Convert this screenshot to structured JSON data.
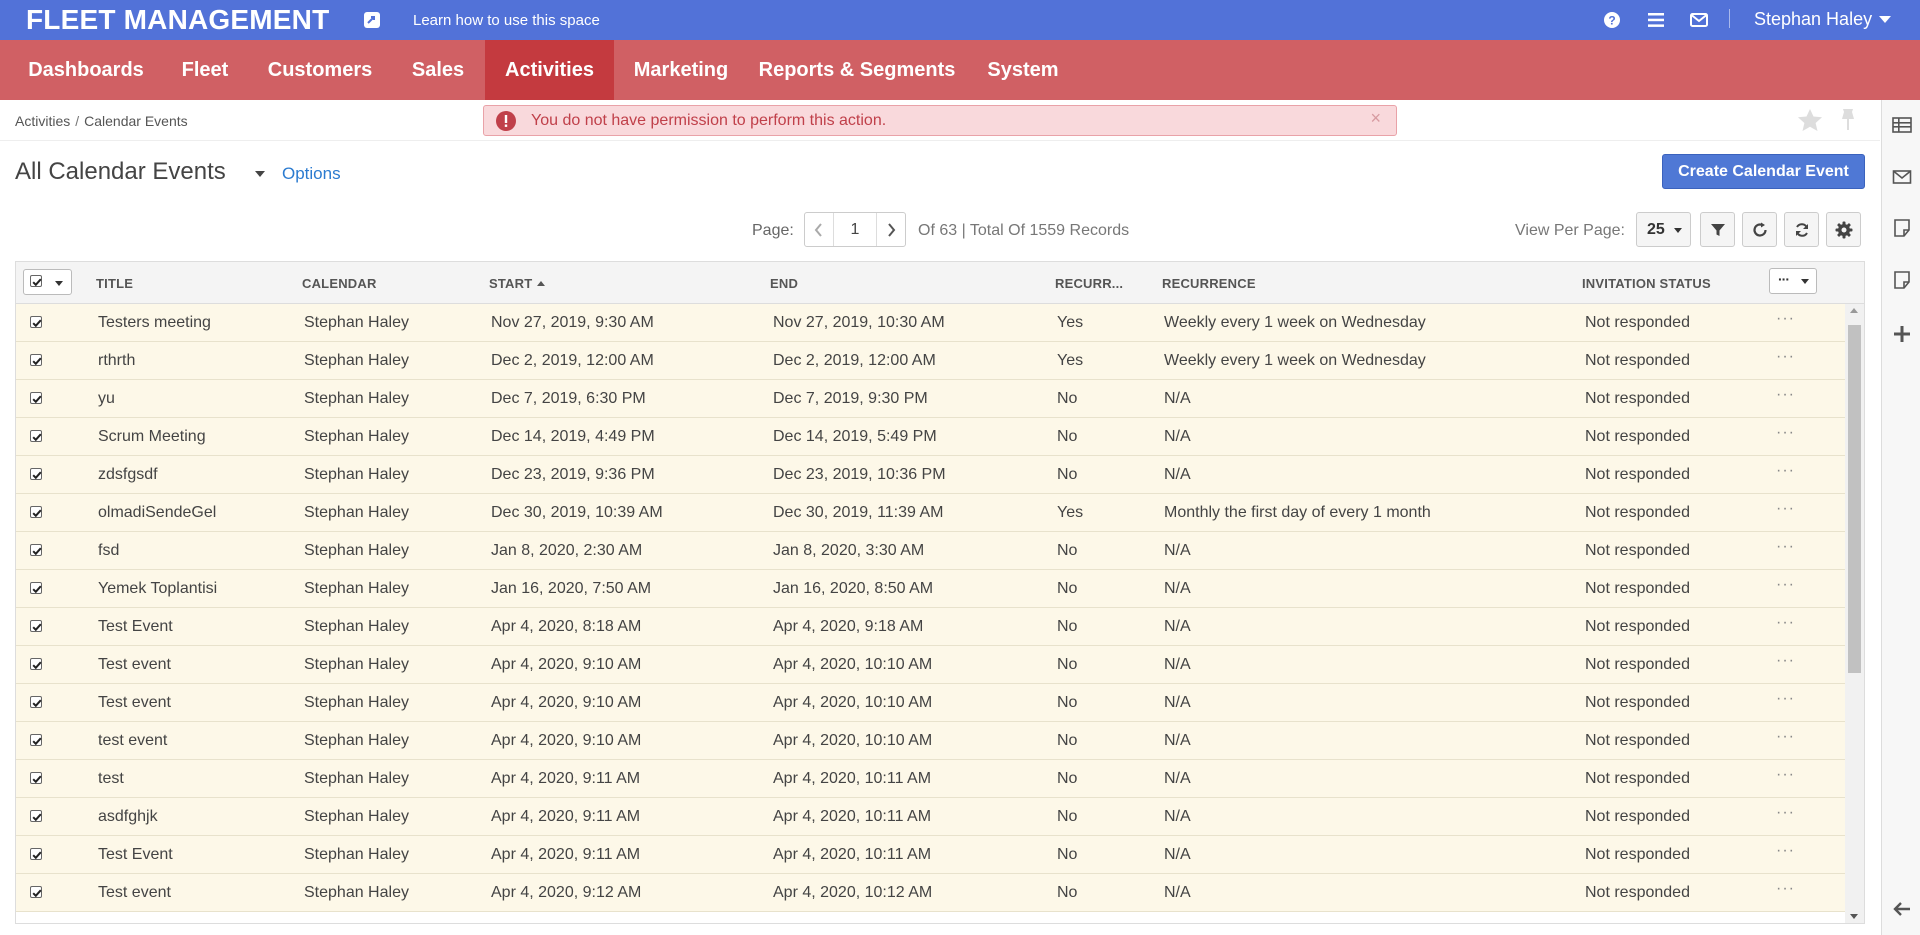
{
  "header": {
    "brand": "FLEET MANAGEMENT",
    "learn_link": "Learn how to use this space",
    "user_name": "Stephan Haley",
    "icons": [
      "help-icon",
      "list-icon",
      "mail-icon"
    ]
  },
  "nav": {
    "items": [
      "Dashboards",
      "Fleet",
      "Customers",
      "Sales",
      "Activities",
      "Marketing",
      "Reports & Segments",
      "System"
    ],
    "active": "Activities"
  },
  "breadcrumb": {
    "parent": "Activities",
    "current": "Calendar Events"
  },
  "alert": {
    "message": "You do not have permission to perform this action.",
    "close": "×"
  },
  "page": {
    "title": "All Calendar Events",
    "options_label": "Options",
    "create_button": "Create Calendar Event"
  },
  "pager": {
    "label": "Page:",
    "current": "1",
    "info": "Of 63 | Total Of 1559 Records",
    "view_per_page_label": "View Per Page:",
    "per_page": "25"
  },
  "grid": {
    "columns": [
      "TITLE",
      "CALENDAR",
      "START",
      "END",
      "RECURR...",
      "RECURRENCE",
      "INVITATION STATUS"
    ],
    "row_menu": "···",
    "rows": [
      [
        "Testers meeting",
        "Stephan Haley",
        "Nov 27, 2019, 9:30 AM",
        "Nov 27, 2019, 10:30 AM",
        "Yes",
        "Weekly every 1 week on Wednesday",
        "Not responded"
      ],
      [
        "rthrth",
        "Stephan Haley",
        "Dec 2, 2019, 12:00 AM",
        "Dec 2, 2019, 12:00 AM",
        "Yes",
        "Weekly every 1 week on Wednesday",
        "Not responded"
      ],
      [
        "yu",
        "Stephan Haley",
        "Dec 7, 2019, 6:30 PM",
        "Dec 7, 2019, 9:30 PM",
        "No",
        "N/A",
        "Not responded"
      ],
      [
        "Scrum Meeting",
        "Stephan Haley",
        "Dec 14, 2019, 4:49 PM",
        "Dec 14, 2019, 5:49 PM",
        "No",
        "N/A",
        "Not responded"
      ],
      [
        "zdsfgsdf",
        "Stephan Haley",
        "Dec 23, 2019, 9:36 PM",
        "Dec 23, 2019, 10:36 PM",
        "No",
        "N/A",
        "Not responded"
      ],
      [
        "olmadiSendeGel",
        "Stephan Haley",
        "Dec 30, 2019, 10:39 AM",
        "Dec 30, 2019, 11:39 AM",
        "Yes",
        "Monthly the first day of every 1 month",
        "Not responded"
      ],
      [
        "fsd",
        "Stephan Haley",
        "Jan 8, 2020, 2:30 AM",
        "Jan 8, 2020, 3:30 AM",
        "No",
        "N/A",
        "Not responded"
      ],
      [
        "Yemek Toplantisi",
        "Stephan Haley",
        "Jan 16, 2020, 7:50 AM",
        "Jan 16, 2020, 8:50 AM",
        "No",
        "N/A",
        "Not responded"
      ],
      [
        "Test Event",
        "Stephan Haley",
        "Apr 4, 2020, 8:18 AM",
        "Apr 4, 2020, 9:18 AM",
        "No",
        "N/A",
        "Not responded"
      ],
      [
        "Test event",
        "Stephan Haley",
        "Apr 4, 2020, 9:10 AM",
        "Apr 4, 2020, 10:10 AM",
        "No",
        "N/A",
        "Not responded"
      ],
      [
        "Test event",
        "Stephan Haley",
        "Apr 4, 2020, 9:10 AM",
        "Apr 4, 2020, 10:10 AM",
        "No",
        "N/A",
        "Not responded"
      ],
      [
        "test event",
        "Stephan Haley",
        "Apr 4, 2020, 9:10 AM",
        "Apr 4, 2020, 10:10 AM",
        "No",
        "N/A",
        "Not responded"
      ],
      [
        "test",
        "Stephan Haley",
        "Apr 4, 2020, 9:11 AM",
        "Apr 4, 2020, 10:11 AM",
        "No",
        "N/A",
        "Not responded"
      ],
      [
        "asdfghjk",
        "Stephan Haley",
        "Apr 4, 2020, 9:11 AM",
        "Apr 4, 2020, 10:11 AM",
        "No",
        "N/A",
        "Not responded"
      ],
      [
        "Test Event",
        "Stephan Haley",
        "Apr 4, 2020, 9:11 AM",
        "Apr 4, 2020, 10:11 AM",
        "No",
        "N/A",
        "Not responded"
      ],
      [
        "Test event",
        "Stephan Haley",
        "Apr 4, 2020, 9:12 AM",
        "Apr 4, 2020, 10:12 AM",
        "No",
        "N/A",
        "Not responded"
      ]
    ]
  },
  "sidebar_icons": [
    "sidebar-menu-icon",
    "email-icon",
    "note-icon",
    "note-icon",
    "add-icon",
    "collapse-arrow-icon"
  ]
}
